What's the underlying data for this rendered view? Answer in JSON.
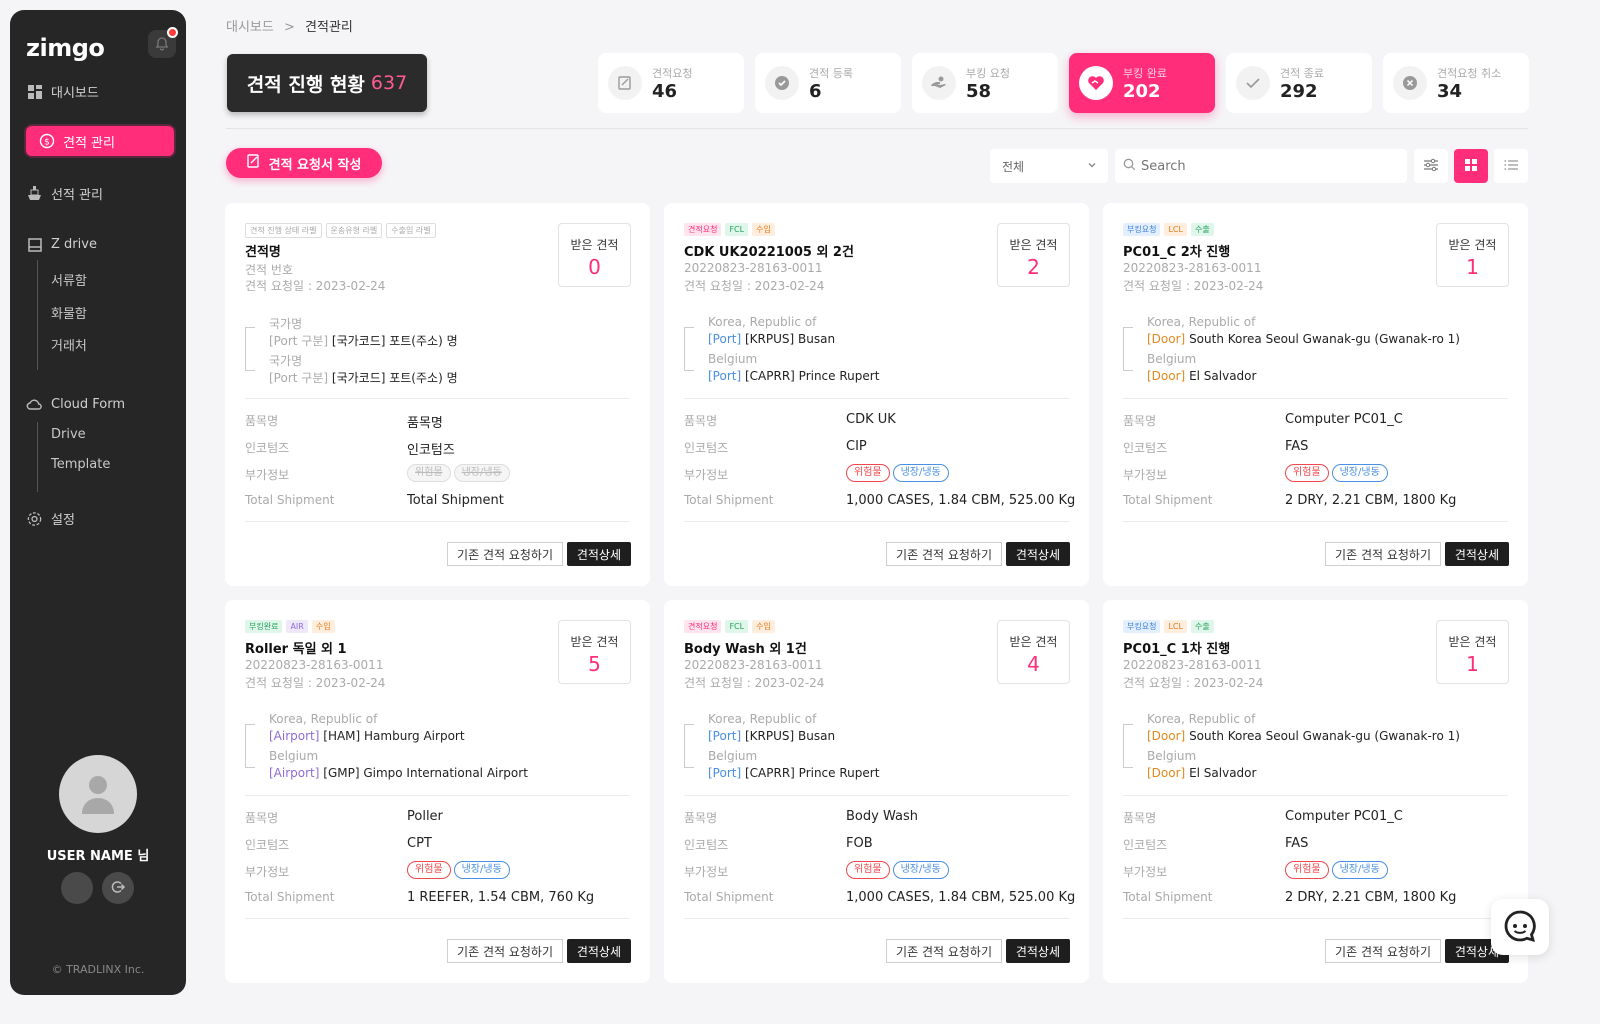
{
  "brand": {
    "logo": "zimgo",
    "accent": "#ff2d7a"
  },
  "sidebar": {
    "items": [
      {
        "label": "대시보드",
        "icon": "grid-icon"
      },
      {
        "label": "견적 관리",
        "icon": "dollar-circle-icon",
        "active": true
      },
      {
        "label": "선적 관리",
        "icon": "ship-icon"
      },
      {
        "label": "Z drive",
        "icon": "box-icon"
      },
      {
        "label": "서류함"
      },
      {
        "label": "화물함"
      },
      {
        "label": "거래처"
      },
      {
        "label": "Cloud Form",
        "icon": "cloud-icon"
      },
      {
        "label": "Drive"
      },
      {
        "label": "Template"
      },
      {
        "label": "설정",
        "icon": "gear-icon"
      }
    ],
    "user_name": "USER NAME 님",
    "copyright": "© TRADLINX Inc."
  },
  "breadcrumb": {
    "parent": "대시보드",
    "sep": ">",
    "current": "견적관리"
  },
  "status": {
    "label": "견적 진행 현황",
    "total": "637"
  },
  "stats": [
    {
      "label": "견적요청",
      "value": "46",
      "icon": "edit-doc-icon"
    },
    {
      "label": "견적 등록",
      "value": "6",
      "icon": "check-circle-icon"
    },
    {
      "label": "부킹 요청",
      "value": "58",
      "icon": "hand-icon"
    },
    {
      "label": "부킹 완료",
      "value": "202",
      "icon": "heart-handshake-icon",
      "active": true
    },
    {
      "label": "견적 종료",
      "value": "292",
      "icon": "check-icon"
    },
    {
      "label": "견적요청 취소",
      "value": "34",
      "icon": "x-circle-icon"
    }
  ],
  "toolbar": {
    "create_label": "견적 요청서 작성",
    "filter_value": "전체",
    "search_placeholder": "Search"
  },
  "labels": {
    "received": "받은 견적",
    "item": "품목명",
    "incoterms": "인코텀즈",
    "extra": "부가정보",
    "shipment": "Total Shipment",
    "req_btn": "기존 견적 요청하기",
    "detail_btn": "견적상세"
  },
  "cards": [
    {
      "tags": [
        {
          "t": "견적 진행 상태 라벨",
          "c": "gray"
        },
        {
          "t": "운송유형 라벨",
          "c": "gray"
        },
        {
          "t": "수출입 라벨",
          "c": "gray"
        }
      ],
      "title": "견적명",
      "no": "견적 번호",
      "date": "견적 요청일 : 2023-02-24",
      "received": "0",
      "o_country": "국가명",
      "o_type": "[Port 구분]",
      "o_port": "[국가코드] 포트(주소) 명",
      "d_country": "국가명",
      "d_type": "[Port 구분]",
      "d_port": "[국가코드] 포트(주소) 명",
      "type_color": "#aaaaaa",
      "item": "품목명",
      "incoterms": "인코텀즈",
      "pills": [
        {
          "t": "위험물",
          "c": "gray"
        },
        {
          "t": "냉장/냉동",
          "c": "gray"
        }
      ],
      "shipment": "Total Shipment"
    },
    {
      "tags": [
        {
          "t": "견적요청",
          "c": "pink"
        },
        {
          "t": "FCL",
          "c": "green"
        },
        {
          "t": "수입",
          "c": "orange"
        }
      ],
      "title": "CDK UK20221005 외 2건",
      "no": "20220823-28163-0011",
      "date": "견적 요청일 : 2023-02-24",
      "received": "2",
      "o_country": "Korea, Republic of",
      "o_type": "[Port]",
      "o_port": "[KRPUS] Busan",
      "d_country": "Belgium",
      "d_type": "[Port]",
      "d_port": "[CAPRR] Prince Rupert",
      "type_color": "#4a90e2",
      "item": "CDK UK",
      "incoterms": "CIP",
      "pills": [
        {
          "t": "위험물",
          "c": "red"
        },
        {
          "t": "냉장/냉동",
          "c": "blue"
        }
      ],
      "shipment": "1,000 CASES, 1.84 CBM, 525.00 Kg"
    },
    {
      "tags": [
        {
          "t": "부킹요청",
          "c": "blue"
        },
        {
          "t": "LCL",
          "c": "orange"
        },
        {
          "t": "수출",
          "c": "green"
        }
      ],
      "title": "PC01_C 2차 진행",
      "no": "20220823-28163-0011",
      "date": "견적 요청일 : 2023-02-24",
      "received": "1",
      "o_country": "Korea, Republic of",
      "o_type": "[Door]",
      "o_port": "South Korea Seoul Gwanak-gu (Gwanak-ro 1)",
      "d_country": "Belgium",
      "d_type": "[Door]",
      "d_port": "El Salvador",
      "type_color": "#e08a1e",
      "item": "Computer PC01_C",
      "incoterms": "FAS",
      "pills": [
        {
          "t": "위험물",
          "c": "red"
        },
        {
          "t": "냉장/냉동",
          "c": "blue"
        }
      ],
      "shipment": "2 DRY, 2.21 CBM, 1800 Kg"
    },
    {
      "tags": [
        {
          "t": "부킹완료",
          "c": "green"
        },
        {
          "t": "AIR",
          "c": "purple"
        },
        {
          "t": "수입",
          "c": "orange"
        }
      ],
      "title": "Roller 독일 외 1",
      "no": "20220823-28163-0011",
      "date": "견적 요청일 : 2023-02-24",
      "received": "5",
      "o_country": "Korea, Republic of",
      "o_type": "[Airport]",
      "o_port": "[HAM] Hamburg Airport",
      "d_country": "Belgium",
      "d_type": "[Airport]",
      "d_port": "[GMP] Gimpo International Airport",
      "type_color": "#8e6bd8",
      "item": "Poller",
      "incoterms": "CPT",
      "pills": [
        {
          "t": "위험물",
          "c": "red"
        },
        {
          "t": "냉장/냉동",
          "c": "blue"
        }
      ],
      "shipment": "1 REEFER, 1.54 CBM, 760 Kg"
    },
    {
      "tags": [
        {
          "t": "견적요청",
          "c": "pink"
        },
        {
          "t": "FCL",
          "c": "green"
        },
        {
          "t": "수입",
          "c": "orange"
        }
      ],
      "title": "Body Wash 외 1건",
      "no": "20220823-28163-0011",
      "date": "견적 요청일 : 2023-02-24",
      "received": "4",
      "o_country": "Korea, Republic of",
      "o_type": "[Port]",
      "o_port": "[KRPUS] Busan",
      "d_country": "Belgium",
      "d_type": "[Port]",
      "d_port": "[CAPRR] Prince Rupert",
      "type_color": "#4a90e2",
      "item": "Body Wash",
      "incoterms": "FOB",
      "pills": [
        {
          "t": "위험물",
          "c": "red"
        },
        {
          "t": "냉장/냉동",
          "c": "blue"
        }
      ],
      "shipment": "1,000 CASES, 1.84 CBM, 525.00 Kg"
    },
    {
      "tags": [
        {
          "t": "부킹요청",
          "c": "blue"
        },
        {
          "t": "LCL",
          "c": "orange"
        },
        {
          "t": "수출",
          "c": "green"
        }
      ],
      "title": "PC01_C 1차 진행",
      "no": "20220823-28163-0011",
      "date": "견적 요청일 : 2023-02-24",
      "received": "1",
      "o_country": "Korea, Republic of",
      "o_type": "[Door]",
      "o_port": "South Korea Seoul Gwanak-gu (Gwanak-ro 1)",
      "d_country": "Belgium",
      "d_type": "[Door]",
      "d_port": "El Salvador",
      "type_color": "#e08a1e",
      "item": "Computer PC01_C",
      "incoterms": "FAS",
      "pills": [
        {
          "t": "위험물",
          "c": "red"
        },
        {
          "t": "냉장/냉동",
          "c": "blue"
        }
      ],
      "shipment": "2 DRY, 2.21 CBM, 1800 Kg"
    }
  ]
}
